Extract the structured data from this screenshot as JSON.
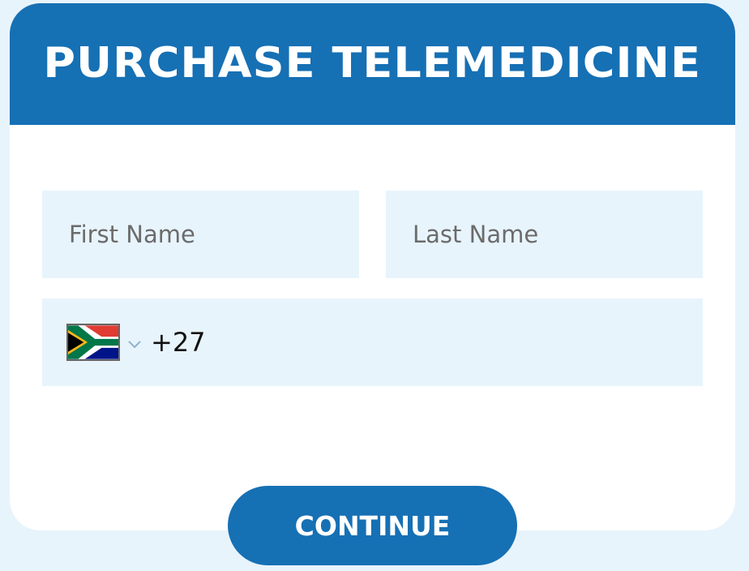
{
  "header": {
    "title": "PURCHASE TELEMEDICINE"
  },
  "form": {
    "first_name": {
      "value": "",
      "placeholder": "First Name"
    },
    "last_name": {
      "value": "",
      "placeholder": "Last Name"
    },
    "phone": {
      "country_icon": "south-africa-flag-icon",
      "dial_code": "+27",
      "value": ""
    }
  },
  "actions": {
    "continue_label": "CONTINUE"
  },
  "colors": {
    "primary": "#1670b4",
    "field_bg": "#e8f4fc",
    "page_bg": "#e8f4fc",
    "card_bg": "#ffffff"
  }
}
